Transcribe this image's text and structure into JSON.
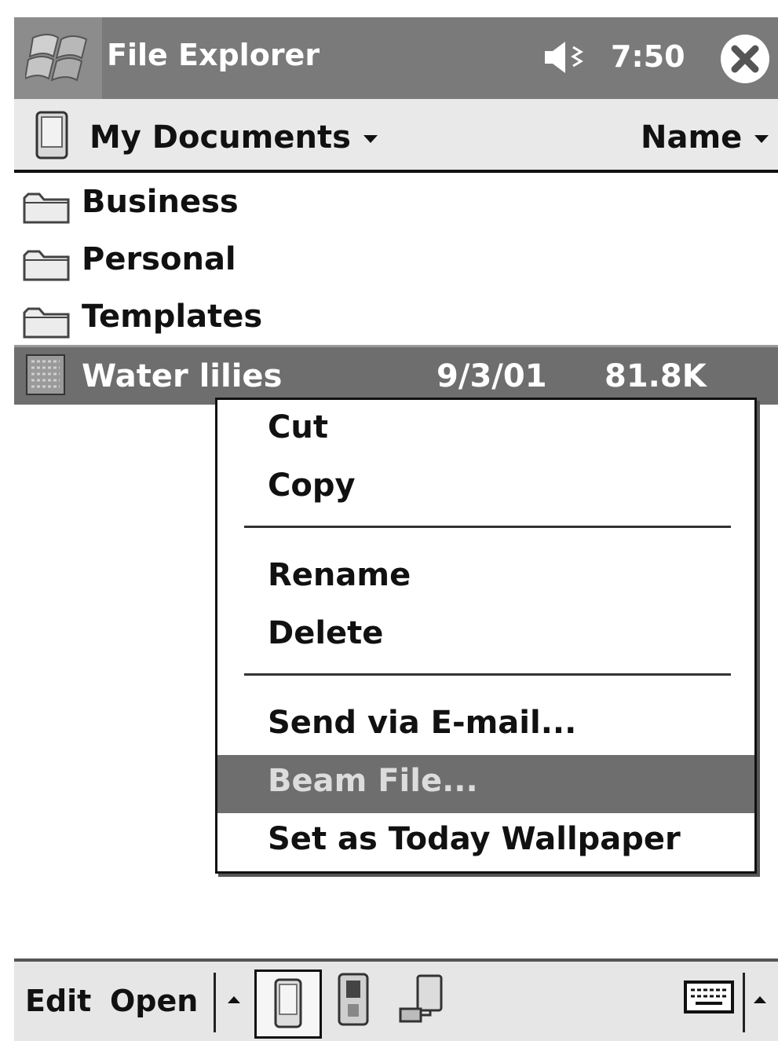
{
  "titlebar": {
    "app_title": "File Explorer",
    "time": "7:50"
  },
  "folderbar": {
    "folder": "My Documents",
    "sort": "Name"
  },
  "files": [
    {
      "name": "Business",
      "type": "folder"
    },
    {
      "name": "Personal",
      "type": "folder"
    },
    {
      "name": "Templates",
      "type": "folder"
    },
    {
      "name": "Water lilies",
      "type": "image",
      "date": "9/3/01",
      "size": "81.8K",
      "selected": true
    }
  ],
  "context_menu": {
    "items": [
      "Cut",
      "Copy",
      "Rename",
      "Delete",
      "Send via E-mail...",
      "Beam File...",
      "Set as Today Wallpaper"
    ],
    "highlighted": "Beam File..."
  },
  "command_bar": {
    "edit": "Edit",
    "open": "Open"
  },
  "icons": [
    "windows-start-icon",
    "speaker-icon",
    "close-icon",
    "device-icon",
    "folder-icon",
    "image-file-icon",
    "pocket-pc-icon",
    "storage-card-icon",
    "network-icon",
    "keyboard-icon"
  ],
  "colors": {
    "titlebar": "#7a7a7a",
    "selection": "#6e6e6e",
    "background": "#ffffff"
  }
}
